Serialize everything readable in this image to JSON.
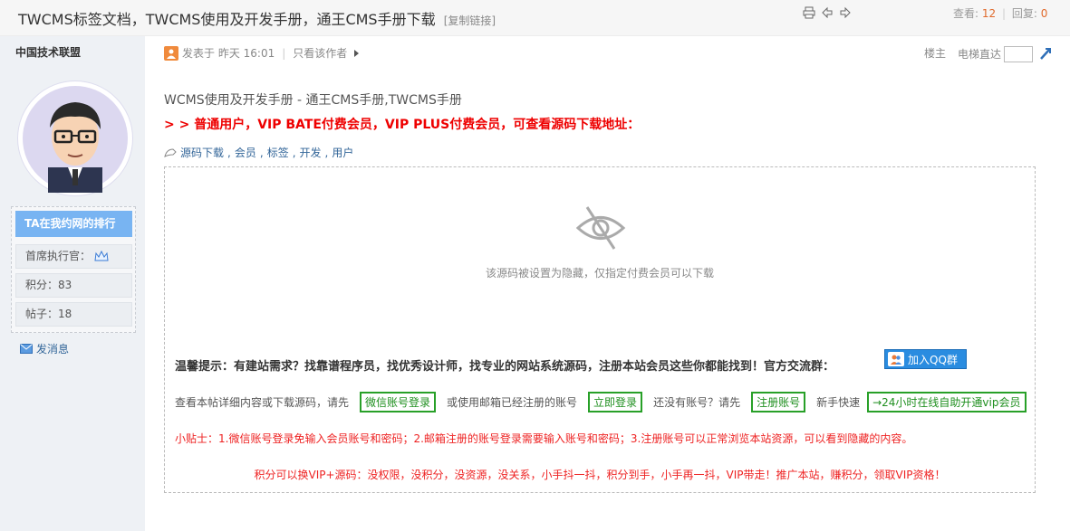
{
  "header": {
    "title": "TWCMS标签文档，TWCMS使用及开发手册，通王CMS手册下载",
    "copy_link": "[复制链接]",
    "views_label": "查看:",
    "views": "12",
    "replies_label": "回复:",
    "replies": "0",
    "icons": [
      "print-icon",
      "prev-thread-icon",
      "next-thread-icon"
    ]
  },
  "sidebar": {
    "user_name": "中国技术联盟",
    "rank_title": "TA在我约网的排行",
    "rank_rows": [
      {
        "label": "首席执行官："
      },
      {
        "label": "积分：83"
      },
      {
        "label": "帖子：18"
      }
    ],
    "send_message": "发消息"
  },
  "post": {
    "posted_at": "发表于 昨天 16:01",
    "only_author": "只看该作者",
    "floor": "楼主",
    "elevator": "电梯直达",
    "subject": "WCMS使用及开发手册 - 通王CMS手册,TWCMS手册",
    "notice": "> > 普通用户，VIP BATE付费会员，VIP PLUS付费会员，可查看源码下载地址：",
    "tags": [
      "源码下载",
      "会员",
      "标签",
      "开发",
      "用户"
    ]
  },
  "hidden": {
    "message": "该源码被设置为隐藏，仅指定付费会员可以下载",
    "tip": "温馨提示：有建站需求？找靠谱程序员，找优秀设计师，找专业的网站系统源码，注册本站会员这些你都能找到！官方交流群：",
    "qq_button": "加入QQ群",
    "login_prompt": "查看本帖详细内容或下载源码，请先",
    "wechat_login": "微信账号登录",
    "or_email": "或使用邮箱已经注册的账号",
    "login_now": "立即登录",
    "no_account": "还没有账号？请先",
    "register": "注册账号",
    "newbie": "新手快速",
    "vip_open": "→24小时在线自助开通vip会员",
    "small_tips": "小贴士：1.微信账号登录免输入会员账号和密码；2.邮箱注册的账号登录需要输入账号和密码；3.注册账号可以正常浏览本站资源，可以看到隐藏的内容。",
    "slogan": "积分可以换VIP+源码：没权限，没积分，没资源，没关系，小手抖一抖，积分到手，小手再一抖，VIP带走！推广本站，赚积分，领取VIP资格！"
  }
}
